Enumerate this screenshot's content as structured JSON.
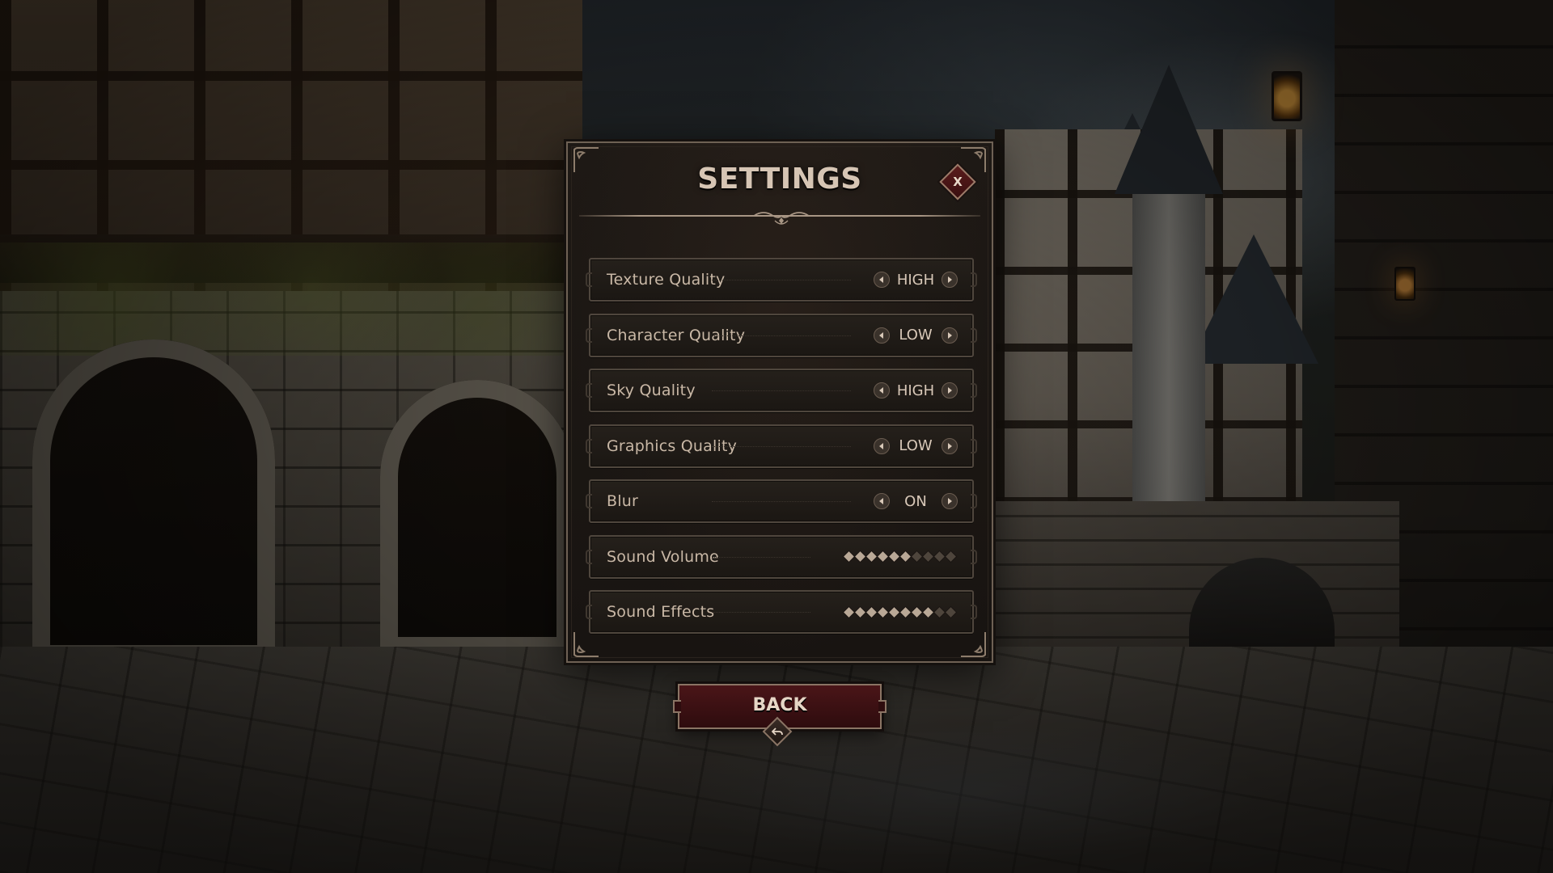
{
  "settings": {
    "title": "SETTINGS",
    "close_label": "X",
    "rows": [
      {
        "label": "Texture Quality",
        "value": "HIGH"
      },
      {
        "label": "Character Quality",
        "value": "LOW"
      },
      {
        "label": "Sky Quality",
        "value": "HIGH"
      },
      {
        "label": "Graphics Quality",
        "value": "LOW"
      },
      {
        "label": "Blur",
        "value": "ON"
      }
    ],
    "sliders": [
      {
        "label": "Sound Volume",
        "level": 6,
        "max": 10
      },
      {
        "label": "Sound Effects",
        "level": 8,
        "max": 10
      }
    ]
  },
  "back": {
    "label": "BACK"
  },
  "icons": {
    "close": "close-icon",
    "left_arrow": "arrow-left-icon",
    "right_arrow": "arrow-right-icon",
    "back": "back-arrow-icon"
  },
  "colors": {
    "panel_bg": "#1b1713",
    "panel_border": "#6e6154",
    "text": "#c9b8a6",
    "accent_red": "#4a1518",
    "pip_on": "#b9a896",
    "pip_off": "#4e453c"
  }
}
